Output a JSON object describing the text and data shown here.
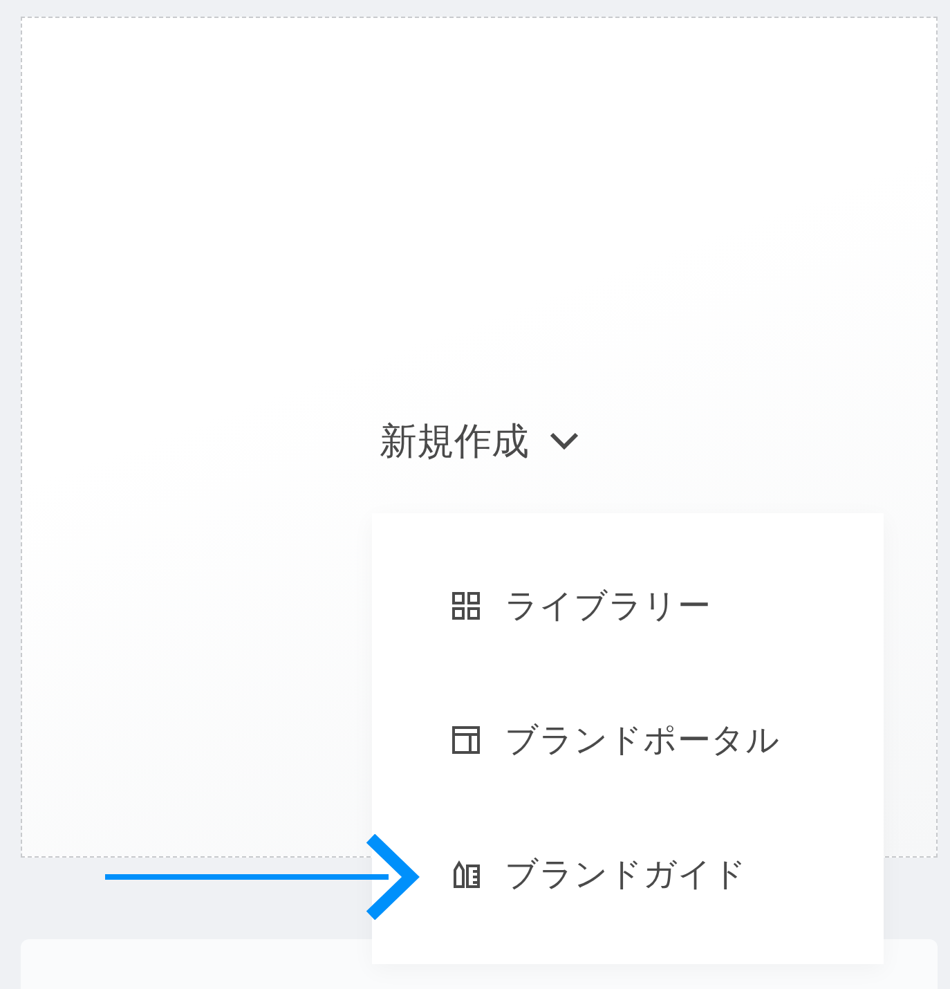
{
  "new_button": {
    "label": "新規作成",
    "expanded": true
  },
  "menu": {
    "items": [
      {
        "label": "ライブラリー",
        "kind": "grid"
      },
      {
        "label": "ブランドポータル",
        "kind": "layout"
      },
      {
        "label": "ブランドガイド",
        "kind": "guide"
      }
    ]
  },
  "annotation": {
    "kind": "arrow"
  }
}
